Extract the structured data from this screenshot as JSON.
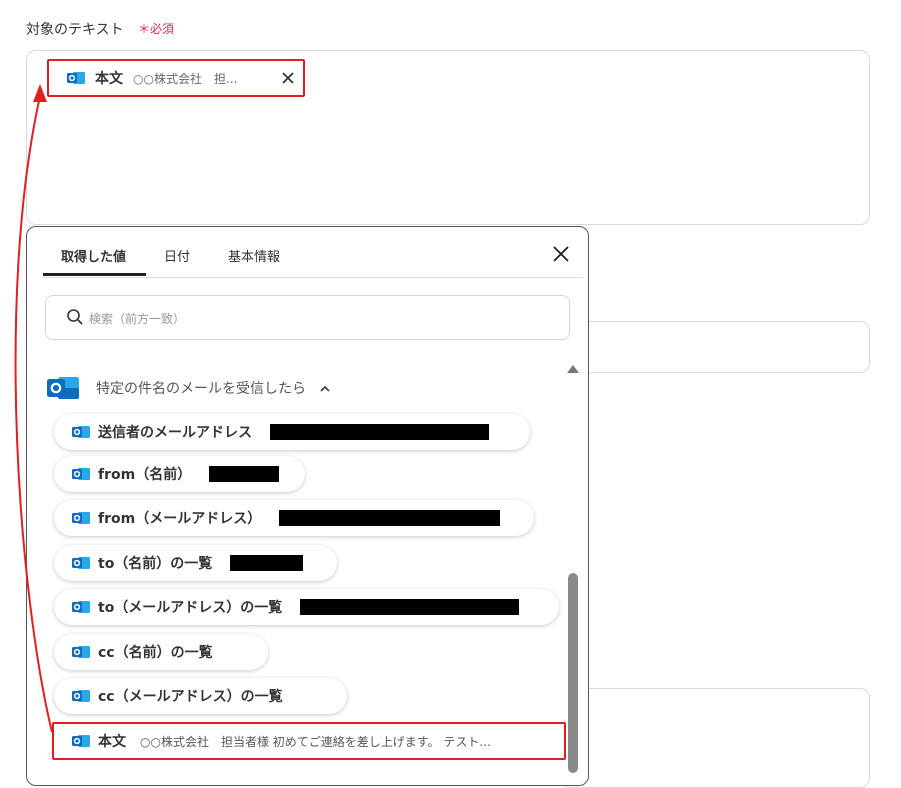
{
  "field": {
    "label": "対象のテキスト",
    "required": "＊必須"
  },
  "selected_chip": {
    "title": "本文",
    "value": "○○株式会社　担...",
    "close_icon": "close-icon"
  },
  "popup": {
    "tabs": [
      "取得した値",
      "日付",
      "基本情報"
    ],
    "active_tab": 0,
    "search_placeholder": "検索（前方一致）",
    "group_title": "特定の件名のメールを受信したら",
    "items": [
      {
        "label": "送信者のメールアドレス"
      },
      {
        "label": "from（名前）"
      },
      {
        "label": "from（メールアドレス）"
      },
      {
        "label": "to（名前）の一覧"
      },
      {
        "label": "to（メールアドレス）の一覧"
      },
      {
        "label": "cc（名前）の一覧"
      },
      {
        "label": "cc（メールアドレス）の一覧"
      }
    ],
    "highlighted_item": {
      "label": "本文",
      "value": "○○株式会社　担当者様 初めてご連絡を差し上げます。 テスト..."
    }
  },
  "colors": {
    "highlight": "#e02020",
    "required": "#e0245e",
    "outlook_blue": "#0f6cbd"
  }
}
